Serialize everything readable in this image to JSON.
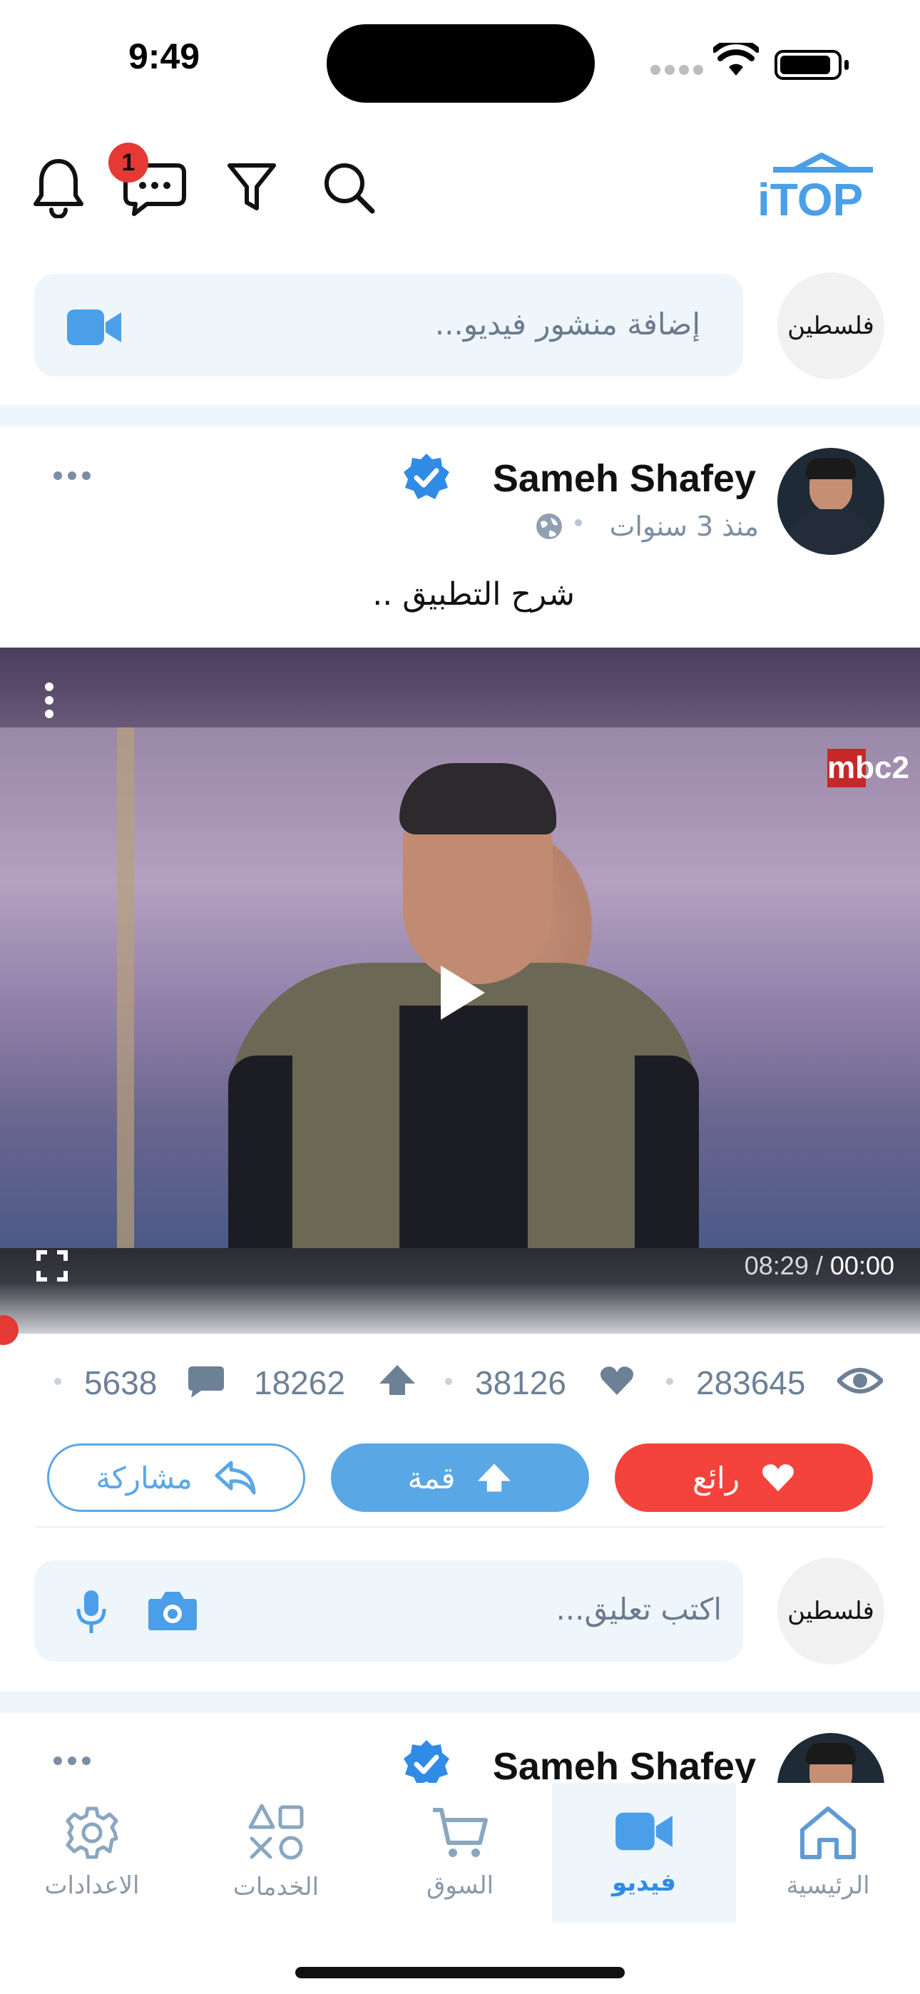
{
  "status_bar": {
    "time": "9:49"
  },
  "header": {
    "logo_text": "iTOP",
    "message_badge_count": "1",
    "icons": [
      "bell-icon",
      "chat-icon",
      "filter-icon",
      "search-icon"
    ]
  },
  "composer": {
    "page_logo_text": "فلسطين",
    "placeholder": "إضافة منشور فيديو..."
  },
  "post": {
    "author": "Sameh Shafey",
    "verified": true,
    "time_ago": "منذ 3 سنوات",
    "text": "شرح التطبيق ..",
    "video": {
      "current_time": "00:00",
      "duration": "08:29",
      "channel_logo": "mbc2",
      "progress": 0
    },
    "stats": {
      "views": "283645",
      "loves": "38126",
      "ups": "18262",
      "comments": "5638"
    },
    "actions": {
      "love_label": "رائع",
      "up_label": "قمة",
      "share_label": "مشاركة"
    },
    "comment_placeholder": "اكتب تعليق..."
  },
  "next_post": {
    "author": "Sameh Shafey"
  },
  "bottom_nav": {
    "items": [
      {
        "label": "الرئيسية",
        "icon": "home-icon"
      },
      {
        "label": "فيديو",
        "icon": "video-icon",
        "active": true
      },
      {
        "label": "السوق",
        "icon": "cart-icon"
      },
      {
        "label": "الخدمات",
        "icon": "services-icon"
      },
      {
        "label": "الاعدادات",
        "icon": "gear-icon"
      }
    ]
  },
  "colors": {
    "brand_blue": "#4a9fe8",
    "love_red": "#f4433c",
    "up_blue": "#5aa7e6",
    "verified_blue": "#2f8be6"
  }
}
